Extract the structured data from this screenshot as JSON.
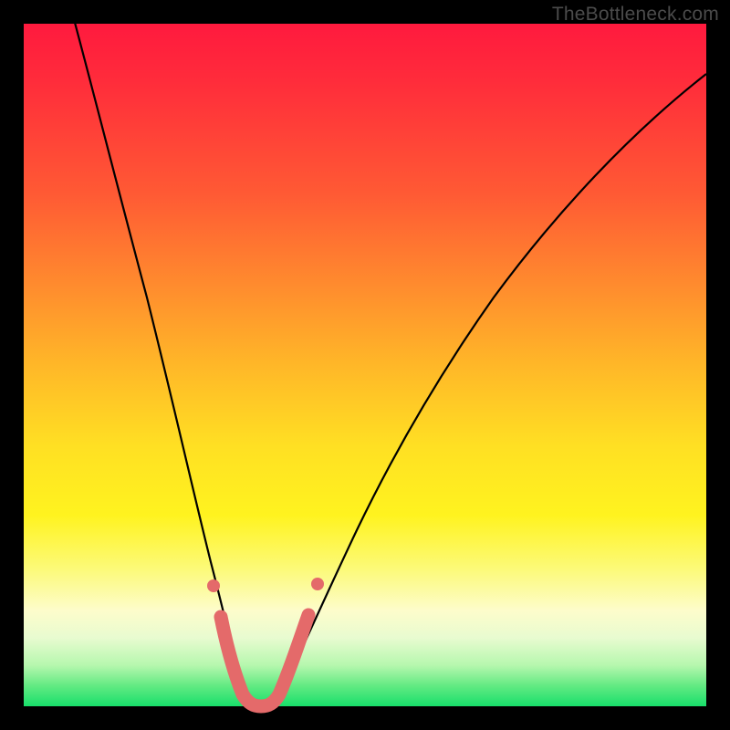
{
  "watermark": "TheBottleneck.com",
  "colors": {
    "frame": "#000000",
    "gradient_top": "#ff1a3e",
    "gradient_mid": "#ffe023",
    "gradient_bottom": "#18df6b",
    "curve": "#000000",
    "marker_stroke": "#e46a6a",
    "marker_fill": "#e46a6a"
  },
  "chart_data": {
    "type": "line",
    "title": "",
    "xlabel": "",
    "ylabel": "",
    "xlim": [
      0,
      100
    ],
    "ylim": [
      0,
      100
    ],
    "grid": false,
    "note": "Background is a vertical gradient heatmap: color encodes y-value (red=high, green=low). Curve is a V-shaped bottleneck profile with minimum near x≈33.",
    "series": [
      {
        "name": "curve",
        "x": [
          0,
          3,
          6,
          9,
          12,
          15,
          18,
          21,
          24,
          27,
          29,
          31,
          33,
          35,
          37,
          40,
          44,
          50,
          56,
          62,
          70,
          78,
          86,
          94,
          100
        ],
        "y": [
          110,
          98,
          86,
          74,
          63,
          52,
          42,
          33,
          24,
          16,
          9,
          3,
          0,
          0,
          3,
          8,
          14,
          23,
          32,
          41,
          52,
          62,
          71,
          78,
          83
        ]
      },
      {
        "name": "markers",
        "x": [
          27.5,
          29.5,
          30.8,
          32.2,
          33.6,
          35.0,
          36.4,
          37.8,
          39.2,
          41.8
        ],
        "y": [
          14.0,
          7.0,
          3.4,
          1.3,
          0.4,
          0.4,
          1.3,
          3.4,
          7.0,
          14.0
        ]
      }
    ]
  }
}
